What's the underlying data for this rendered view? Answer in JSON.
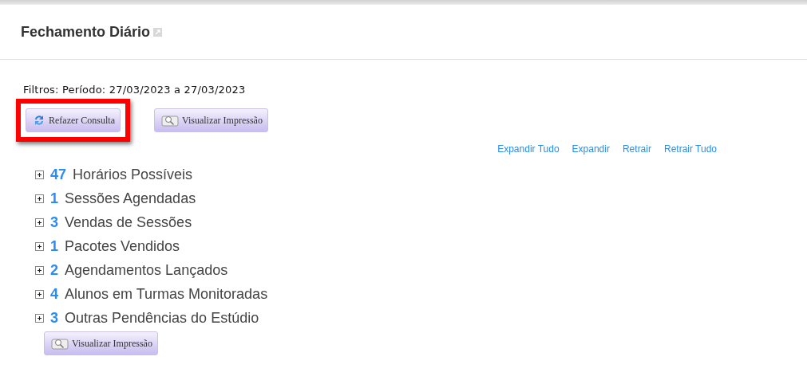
{
  "title": "Fechamento Diário",
  "filters": "Filtros: Período: 27/03/2023 a 27/03/2023",
  "buttons": [
    {
      "kind": "refresh",
      "label": "Refazer Consulta",
      "highlighted": true
    },
    {
      "kind": "print",
      "label": "Visualizar Impressão",
      "highlighted": false
    }
  ],
  "links": [
    "Expandir Tudo",
    "Expandir",
    "Retrair",
    "Retrair Tudo"
  ],
  "items": [
    {
      "count": "47",
      "label": "Horários Possíveis",
      "expanded": false
    },
    {
      "count": "1",
      "label": "Sessões Agendadas",
      "expanded": false
    },
    {
      "count": "3",
      "label": "Vendas de Sessões",
      "expanded": false
    },
    {
      "count": "1",
      "label": "Pacotes Vendidos",
      "expanded": false
    },
    {
      "count": "2",
      "label": "Agendamentos Lançados",
      "expanded": false
    },
    {
      "count": "4",
      "label": "Alunos em Turmas Monitoradas",
      "expanded": false
    },
    {
      "count": "3",
      "label": "Outras Pendências do Estúdio",
      "expanded": false
    }
  ],
  "bottom_button": {
    "kind": "print",
    "label": "Visualizar Impressão"
  }
}
